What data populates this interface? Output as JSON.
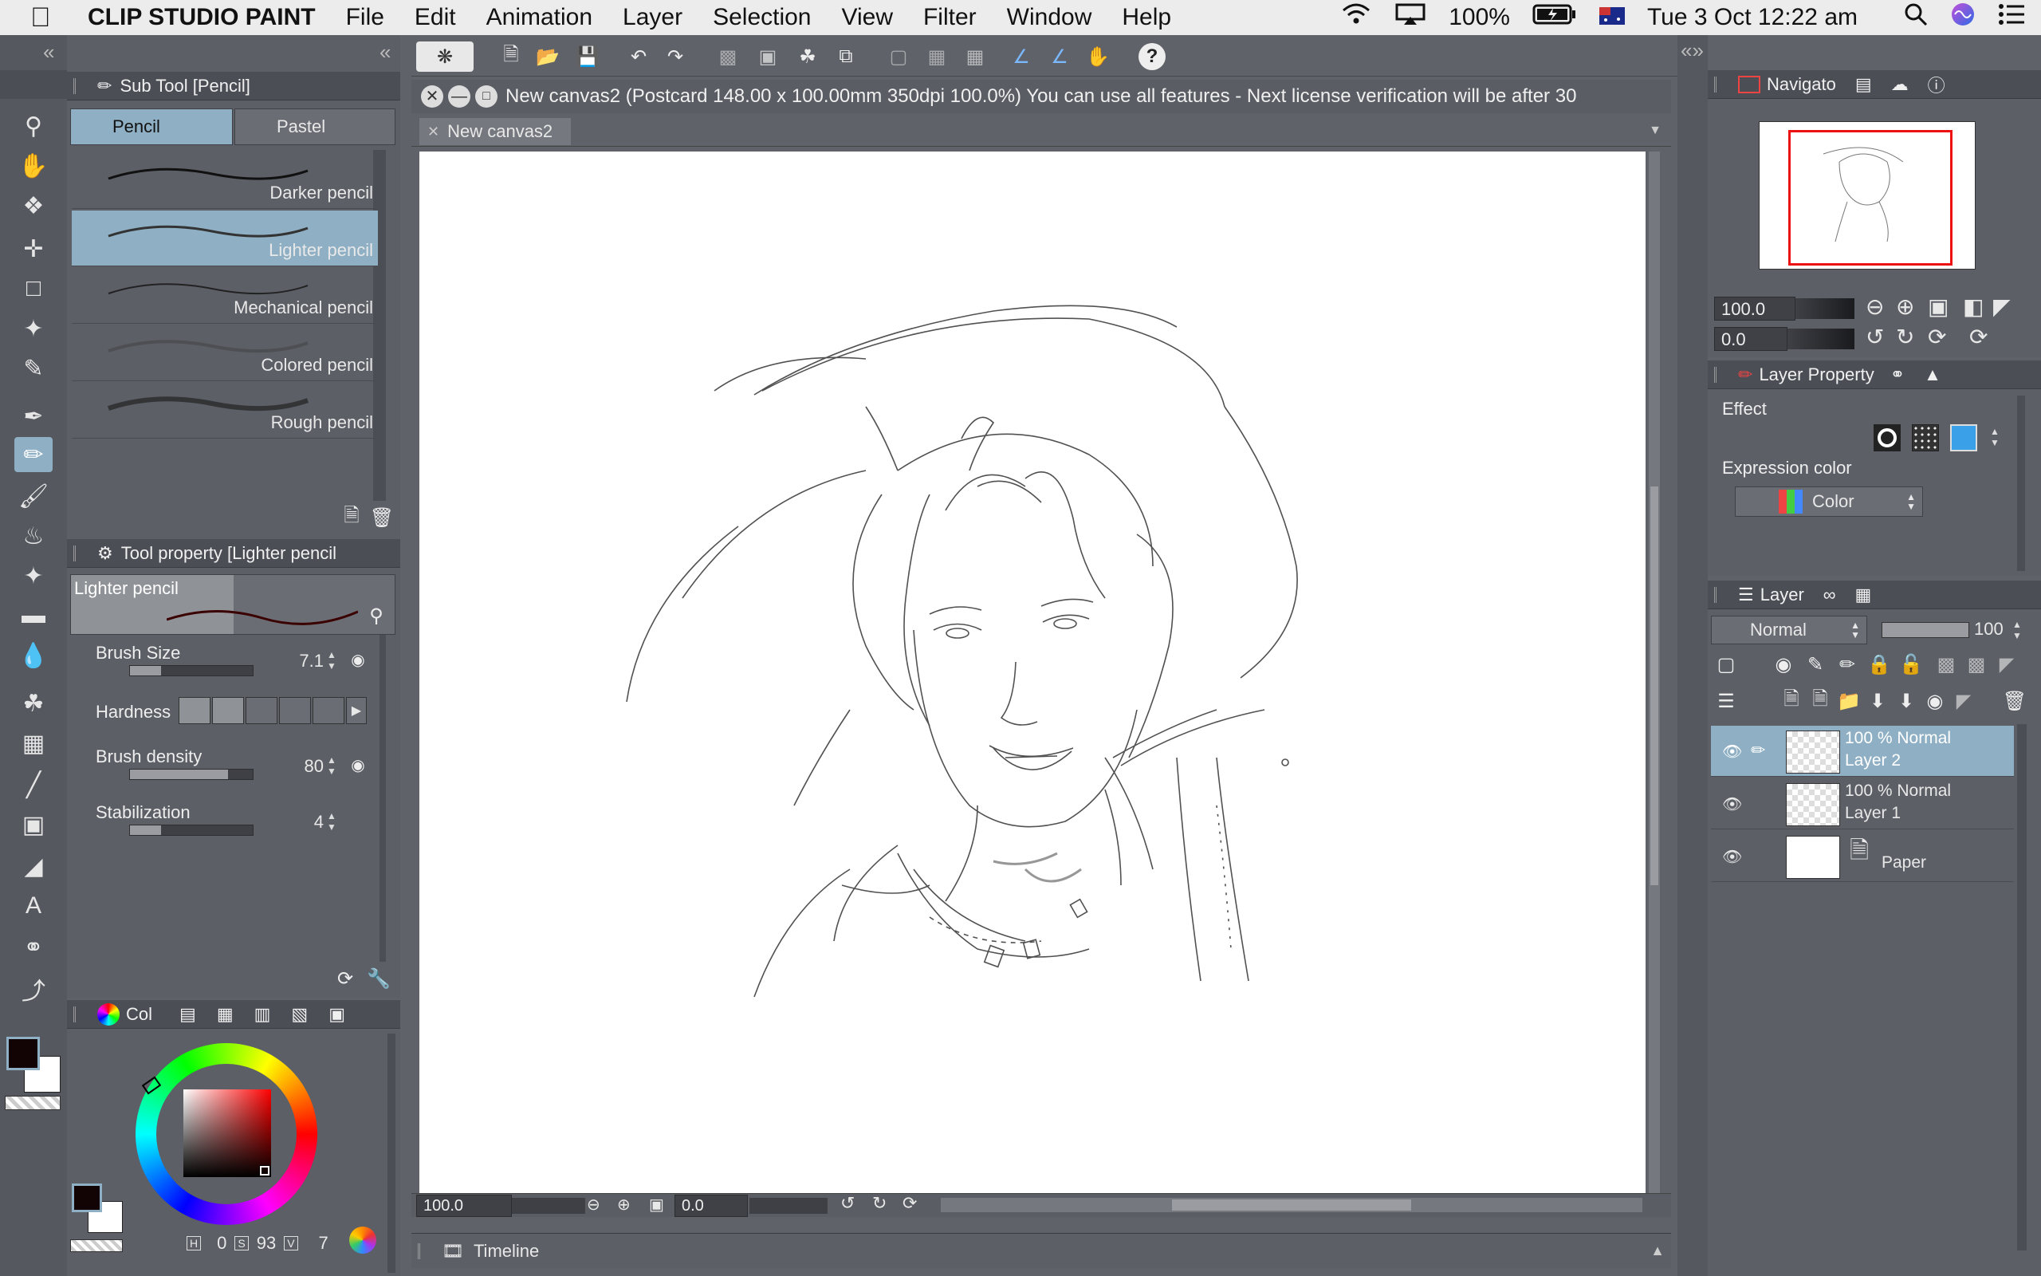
{
  "menubar": {
    "app_name": "CLIP STUDIO PAINT",
    "items": [
      "File",
      "Edit",
      "Animation",
      "Layer",
      "Selection",
      "View",
      "Filter",
      "Window",
      "Help"
    ],
    "battery": "100%",
    "datetime": "Tue 3 Oct  12:22 am"
  },
  "document": {
    "title_bar": "New canvas2 (Postcard 148.00 x 100.00mm 350dpi 100.0%)  You can use all features - Next license verification will be after 30",
    "tab": "New canvas2"
  },
  "subtool": {
    "header": "Sub Tool [Pencil]",
    "tabs": [
      "Pencil",
      "Pastel"
    ],
    "items": [
      "Darker pencil",
      "Lighter pencil",
      "Mechanical pencil",
      "Colored pencil",
      "Rough pencil"
    ]
  },
  "tool_property": {
    "header": "Tool property [Lighter pencil",
    "preset_name": "Lighter pencil",
    "brush_size_label": "Brush Size",
    "brush_size": "7.1",
    "brush_size_fraction": 0.25,
    "hardness_label": "Hardness",
    "brush_density_label": "Brush density",
    "brush_density": "80",
    "brush_density_fraction": 0.8,
    "stabilization_label": "Stabilization",
    "stabilization": "4",
    "stabilization_fraction": 0.25
  },
  "color_panel": {
    "tab_label": "Col",
    "h_label": "H",
    "h": "0",
    "s_label": "S",
    "s": "93",
    "v_label": "V",
    "v": "7"
  },
  "navigator": {
    "tab_label": "Navigato",
    "zoom": "100.0",
    "rotation": "0.0"
  },
  "layer_property": {
    "tab_label": "Layer Property",
    "effect_label": "Effect",
    "expression_color_label": "Expression color",
    "expression_color_value": "Color"
  },
  "layer_panel": {
    "tab_label": "Layer",
    "blend_mode": "Normal",
    "opacity": "100",
    "layers": [
      {
        "line1": "100 % Normal",
        "line2": "Layer 2"
      },
      {
        "line1": "100 % Normal",
        "line2": "Layer 1"
      },
      {
        "line1": "",
        "line2": "Paper"
      }
    ]
  },
  "canvas_status": {
    "zoom": "100.0",
    "angle": "0.0"
  },
  "timeline": {
    "label": "Timeline"
  },
  "colors": {
    "accent": "#8fb0c4",
    "panel_bg": "#5c5f66",
    "main_color": "#120404"
  }
}
